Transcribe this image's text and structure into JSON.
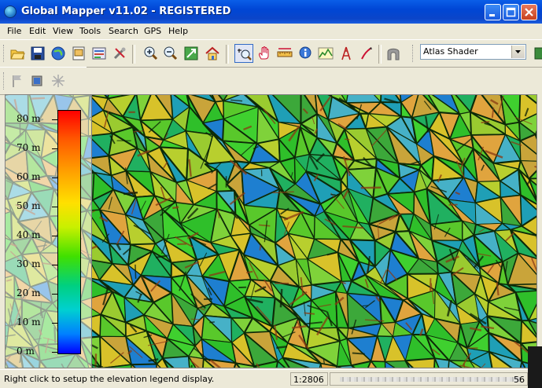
{
  "window": {
    "title": "Global Mapper v11.02 - REGISTERED",
    "app_icon": "globe-icon",
    "controls": [
      "minimize-icon",
      "maximize-icon",
      "close-icon"
    ]
  },
  "menu": [
    {
      "label": "File"
    },
    {
      "label": "Edit"
    },
    {
      "label": "View"
    },
    {
      "label": "Tools"
    },
    {
      "label": "Search"
    },
    {
      "label": "GPS"
    },
    {
      "label": "Help"
    }
  ],
  "toolbar1": {
    "file_buttons": [
      "open-folder-icon",
      "save-disk-icon",
      "globe-download-icon",
      "page-setup-icon",
      "overlay-control-icon",
      "config-tools-icon"
    ],
    "zoom_buttons": [
      "zoom-in-icon",
      "zoom-out-icon",
      "full-view-icon",
      "home-icon"
    ],
    "tool_buttons": [
      "zoom-tool-icon",
      "pan-hand-icon",
      "measure-ruler-icon",
      "feature-info-icon",
      "path-profile-icon",
      "line-of-sight-icon",
      "digitizer-icon"
    ],
    "view_3d_button": "3d-view-icon",
    "shader": {
      "selected": "Atlas Shader"
    }
  },
  "toolbar2": {
    "buttons": [
      "gps-flag-icon",
      "gps-track-icon",
      "gps-satellite-icon"
    ]
  },
  "legend": {
    "labels": [
      "80 m",
      "70 m",
      "60 m",
      "50 m",
      "40 m",
      "30 m",
      "20 m",
      "10 m",
      "0 m"
    ],
    "colors": {
      "top": "#ff0000",
      "mid": "#40e000",
      "bottom": "#0000ff"
    }
  },
  "status": {
    "message": "Right click to setup the elevation legend display.",
    "scale": "1:2806",
    "coords_suffix": "56"
  }
}
